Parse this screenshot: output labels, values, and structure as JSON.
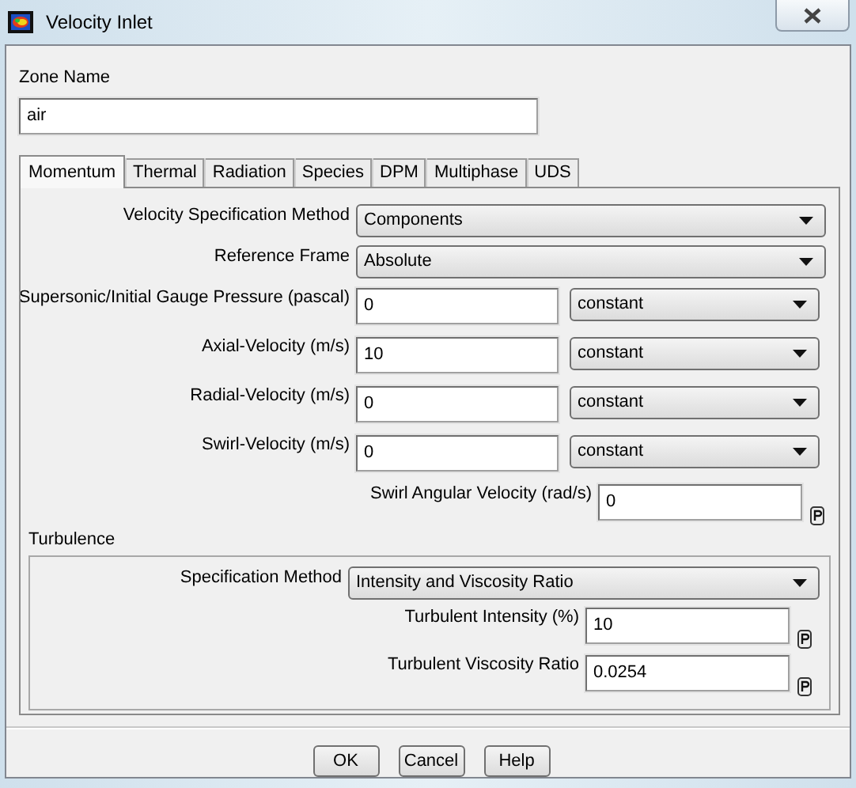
{
  "window": {
    "title": "Velocity Inlet"
  },
  "zone_name": {
    "label": "Zone Name",
    "value": "air"
  },
  "tabs": [
    {
      "label": "Momentum",
      "selected": true
    },
    {
      "label": "Thermal",
      "selected": false
    },
    {
      "label": "Radiation",
      "selected": false
    },
    {
      "label": "Species",
      "selected": false
    },
    {
      "label": "DPM",
      "selected": false
    },
    {
      "label": "Multiphase",
      "selected": false
    },
    {
      "label": "UDS",
      "selected": false
    }
  ],
  "momentum": {
    "fields": [
      {
        "kind": "dropdown",
        "label": "Velocity Specification Method",
        "value": "Components"
      },
      {
        "kind": "dropdown",
        "label": "Reference Frame",
        "value": "Absolute"
      },
      {
        "kind": "input_dropdown",
        "label": "Supersonic/Initial Gauge Pressure (pascal)",
        "value": "0",
        "method": "constant"
      },
      {
        "kind": "input_dropdown",
        "label": "Axial-Velocity (m/s)",
        "value": "10",
        "method": "constant"
      },
      {
        "kind": "input_dropdown",
        "label": "Radial-Velocity (m/s)",
        "value": "0",
        "method": "constant"
      },
      {
        "kind": "input_dropdown",
        "label": "Swirl-Velocity (m/s)",
        "value": "0",
        "method": "constant"
      },
      {
        "kind": "param",
        "label": "Swirl Angular Velocity (rad/s)",
        "value": "0"
      }
    ]
  },
  "turbulence": {
    "title": "Turbulence",
    "fields": [
      {
        "kind": "dropdown",
        "label": "Specification Method",
        "value": "Intensity and Viscosity Ratio"
      },
      {
        "kind": "param",
        "label": "Turbulent Intensity (%)",
        "value": "10"
      },
      {
        "kind": "param",
        "label": "Turbulent Viscosity Ratio",
        "value": "0.0254"
      }
    ]
  },
  "buttons": [
    "OK",
    "Cancel",
    "Help"
  ]
}
